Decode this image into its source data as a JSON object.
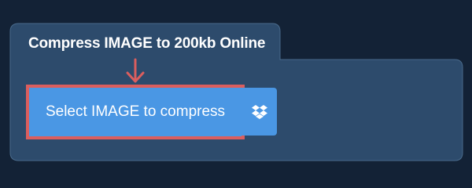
{
  "tab": {
    "title": "Compress IMAGE to 200kb Online"
  },
  "upload": {
    "select_label": "Select IMAGE to compress"
  },
  "icons": {
    "arrow": "arrow-down-icon",
    "dropbox": "dropbox-icon"
  },
  "colors": {
    "page_background": "#132236",
    "panel_background": "#2d4b6c",
    "button_blue": "#4a97e4",
    "highlight_red": "#db5e5e",
    "text_white": "#ffffff"
  }
}
